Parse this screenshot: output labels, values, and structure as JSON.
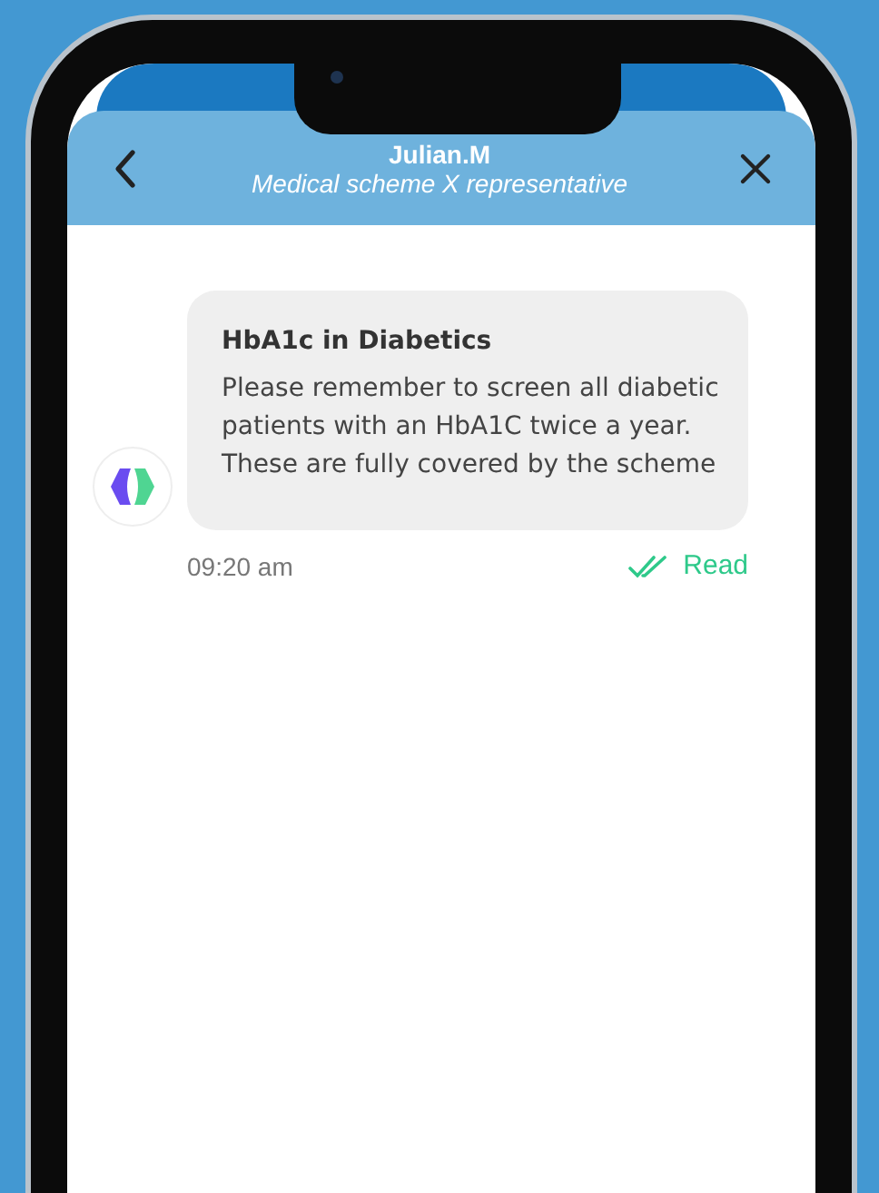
{
  "header": {
    "title": "Julian.M",
    "subtitle": "Medical scheme X representative"
  },
  "messages": [
    {
      "title": "HbA1c in Diabetics",
      "body": "Please remember to screen all diabetic patients with an HbA1C twice a year. These are fully covered by the scheme",
      "time": "09:20 am",
      "status": "Read",
      "read": true
    }
  ]
}
